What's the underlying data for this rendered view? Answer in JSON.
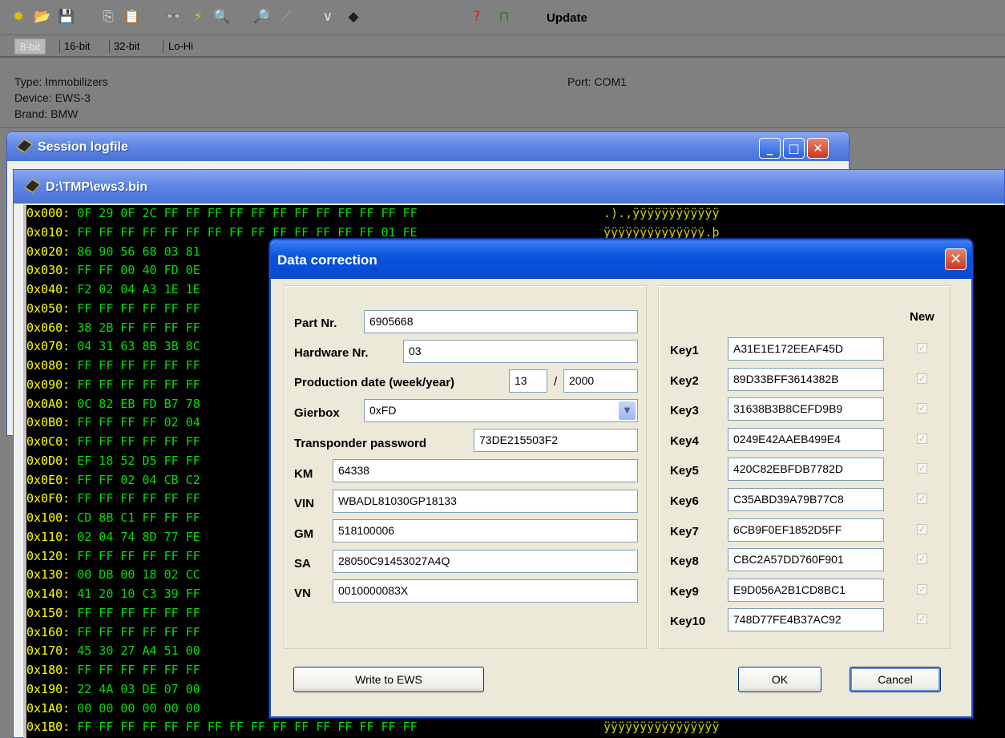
{
  "toolbar": {
    "icons": [
      {
        "name": "new-icon",
        "glyph": "✸",
        "color": "#e0c000"
      },
      {
        "name": "open-folder-icon",
        "glyph": "📂",
        "color": "#e8c040"
      },
      {
        "name": "save-icon",
        "glyph": "💾",
        "color": "#1a2a80"
      },
      {
        "name": "copy-icon",
        "glyph": "⎘",
        "color": "#d8d8d8"
      },
      {
        "name": "paste-icon",
        "glyph": "📋",
        "color": "#3050a0"
      },
      {
        "name": "glasses-icon",
        "glyph": "👓",
        "color": "#303030"
      },
      {
        "name": "lightning-icon",
        "glyph": "⚡",
        "color": "#e0c000"
      },
      {
        "name": "search-icon",
        "glyph": "🔍",
        "color": "#303030"
      },
      {
        "name": "find-next-icon",
        "glyph": "🔎",
        "color": "#303030"
      },
      {
        "name": "wand-icon",
        "glyph": "⟋",
        "color": "#a0a0a0"
      },
      {
        "name": "checkmark-icon",
        "glyph": "∨",
        "color": "#e0e0e0"
      },
      {
        "name": "chip-icon",
        "glyph": "◆",
        "color": "#202020"
      },
      {
        "name": "help-icon",
        "glyph": "?",
        "color": "#e02020"
      },
      {
        "name": "exit-icon",
        "glyph": "⊓",
        "color": "#208020"
      }
    ],
    "update_label": "Update"
  },
  "bit_tabs": [
    "8-bit",
    "16-bit",
    "32-bit",
    "Lo-Hi"
  ],
  "info": {
    "type": "Type: Immobilizers",
    "device": "Device: EWS-3",
    "brand": "Brand: BMW",
    "port": "Port: COM1"
  },
  "session_window": {
    "title": "Session logfile"
  },
  "bin_window": {
    "title": "D:\\TMP\\ews3.bin"
  },
  "hex_rows": [
    {
      "addr": "0x000:",
      "bytes": "0F 29 0F 2C FF FF FF FF FF FF FF FF FF FF FF FF",
      "ascii": ".).,ÿÿÿÿÿÿÿÿÿÿÿÿ"
    },
    {
      "addr": "0x010:",
      "bytes": "FF FF FF FF FF FF FF FF FF FF FF FF FF FF 01 FE",
      "ascii": "ÿÿÿÿÿÿÿÿÿÿÿÿÿÿ.þ"
    },
    {
      "addr": "0x020:",
      "bytes": "86 90 56 68 03 81",
      "ascii": ""
    },
    {
      "addr": "0x030:",
      "bytes": "FF FF 00 40 FD 0E",
      "ascii": ""
    },
    {
      "addr": "0x040:",
      "bytes": "F2 02 04 A3 1E 1E",
      "ascii": ""
    },
    {
      "addr": "0x050:",
      "bytes": "FF FF FF FF FF FF",
      "ascii": ""
    },
    {
      "addr": "0x060:",
      "bytes": "38 2B FF FF FF FF",
      "ascii": ""
    },
    {
      "addr": "0x070:",
      "bytes": "04 31 63 8B 3B 8C",
      "ascii": ""
    },
    {
      "addr": "0x080:",
      "bytes": "FF FF FF FF FF FF",
      "ascii": ""
    },
    {
      "addr": "0x090:",
      "bytes": "FF FF FF FF FF FF",
      "ascii": ""
    },
    {
      "addr": "0x0A0:",
      "bytes": "0C 82 EB FD B7 78",
      "ascii": ""
    },
    {
      "addr": "0x0B0:",
      "bytes": "FF FF FF FF 02 04",
      "ascii": ""
    },
    {
      "addr": "0x0C0:",
      "bytes": "FF FF FF FF FF FF",
      "ascii": ""
    },
    {
      "addr": "0x0D0:",
      "bytes": "EF 18 52 D5 FF FF",
      "ascii": ""
    },
    {
      "addr": "0x0E0:",
      "bytes": "FF FF 02 04 CB C2",
      "ascii": ""
    },
    {
      "addr": "0x0F0:",
      "bytes": "FF FF FF FF FF FF",
      "ascii": ""
    },
    {
      "addr": "0x100:",
      "bytes": "CD 8B C1 FF FF FF",
      "ascii": ""
    },
    {
      "addr": "0x110:",
      "bytes": "02 04 74 8D 77 FE",
      "ascii": ""
    },
    {
      "addr": "0x120:",
      "bytes": "FF FF FF FF FF FF",
      "ascii": ""
    },
    {
      "addr": "0x130:",
      "bytes": "00 DB 00 18 02 CC",
      "ascii": ""
    },
    {
      "addr": "0x140:",
      "bytes": "41 20 10 C3 39 FF",
      "ascii": ""
    },
    {
      "addr": "0x150:",
      "bytes": "FF FF FF FF FF FF",
      "ascii": ""
    },
    {
      "addr": "0x160:",
      "bytes": "FF FF FF FF FF FF",
      "ascii": ""
    },
    {
      "addr": "0x170:",
      "bytes": "45 30 27 A4 51 00",
      "ascii": ""
    },
    {
      "addr": "0x180:",
      "bytes": "FF FF FF FF FF FF",
      "ascii": ""
    },
    {
      "addr": "0x190:",
      "bytes": "22 4A 03 DE 07 00",
      "ascii": ""
    },
    {
      "addr": "0x1A0:",
      "bytes": "00 00 00 00 00 00",
      "ascii": ""
    },
    {
      "addr": "0x1B0:",
      "bytes": "FF FF FF FF FF FF FF FF FF FF FF FF FF FF FF FF",
      "ascii": "ÿÿÿÿÿÿÿÿÿÿÿÿÿÿÿÿ"
    }
  ],
  "dialog": {
    "title": "Data correction",
    "part_nr": {
      "label": "Part Nr.",
      "value": "6905668"
    },
    "hardware_nr": {
      "label": "Hardware Nr.",
      "value": "03"
    },
    "production_date": {
      "label": "Production date (week/year)",
      "week": "13",
      "separator": "/",
      "year": "2000"
    },
    "gierbox": {
      "label": "Gierbox",
      "value": "0xFD"
    },
    "transponder": {
      "label": "Transponder password",
      "value": "73DE215503F2"
    },
    "km": {
      "label": "KM",
      "value": "64338"
    },
    "vin": {
      "label": "VIN",
      "value": "WBADL81030GP18133"
    },
    "gm": {
      "label": "GM",
      "value": "518100006"
    },
    "sa": {
      "label": "SA",
      "value": "28050C91453027A4Q"
    },
    "vn": {
      "label": "VN",
      "value": "0010000083X"
    },
    "new_header": "New",
    "keys": [
      {
        "label": "Key1",
        "value": "A31E1E172EEAF45D"
      },
      {
        "label": "Key2",
        "value": "89D33BFF3614382B"
      },
      {
        "label": "Key3",
        "value": "31638B3B8CEFD9B9"
      },
      {
        "label": "Key4",
        "value": "0249E42AAEB499E4"
      },
      {
        "label": "Key5",
        "value": "420C82EBFDB7782D"
      },
      {
        "label": "Key6",
        "value": "C35ABD39A79B77C8"
      },
      {
        "label": "Key7",
        "value": "6CB9F0EF1852D5FF"
      },
      {
        "label": "Key8",
        "value": "CBC2A57DD760F901"
      },
      {
        "label": "Key9",
        "value": "E9D056A2B1CD8BC1"
      },
      {
        "label": "Key10",
        "value": "748D77FE4B37AC92"
      }
    ],
    "write_button": "Write to EWS",
    "ok_button": "OK",
    "cancel_button": "Cancel"
  }
}
